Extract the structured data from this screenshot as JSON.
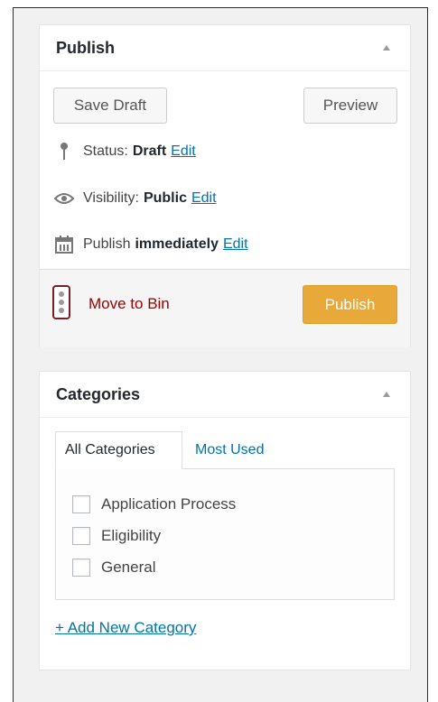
{
  "publish": {
    "title": "Publish",
    "save_draft_label": "Save Draft",
    "preview_label": "Preview",
    "status_label": "Status:",
    "status_value": "Draft",
    "visibility_label": "Visibility:",
    "visibility_value": "Public",
    "schedule_label": "Publish",
    "schedule_value": "immediately",
    "edit_label": "Edit",
    "move_to_bin_label": "Move to Bin",
    "publish_button_label": "Publish"
  },
  "categories": {
    "title": "Categories",
    "tabs": [
      {
        "label": "All Categories",
        "active": true
      },
      {
        "label": "Most Used",
        "active": false
      }
    ],
    "items": [
      {
        "label": "Application Process",
        "checked": false
      },
      {
        "label": "Eligibility",
        "checked": false
      },
      {
        "label": "General",
        "checked": false
      }
    ],
    "add_new_label": "+ Add New Category"
  },
  "colors": {
    "publish_button": "#e9a93a",
    "link": "#0073aa",
    "delete_link": "#a00000"
  },
  "icons": {
    "status": "pin-icon",
    "visibility": "eye-icon",
    "schedule": "calendar-icon",
    "bin": "trash-icon",
    "collapse": "caret-up-icon"
  }
}
